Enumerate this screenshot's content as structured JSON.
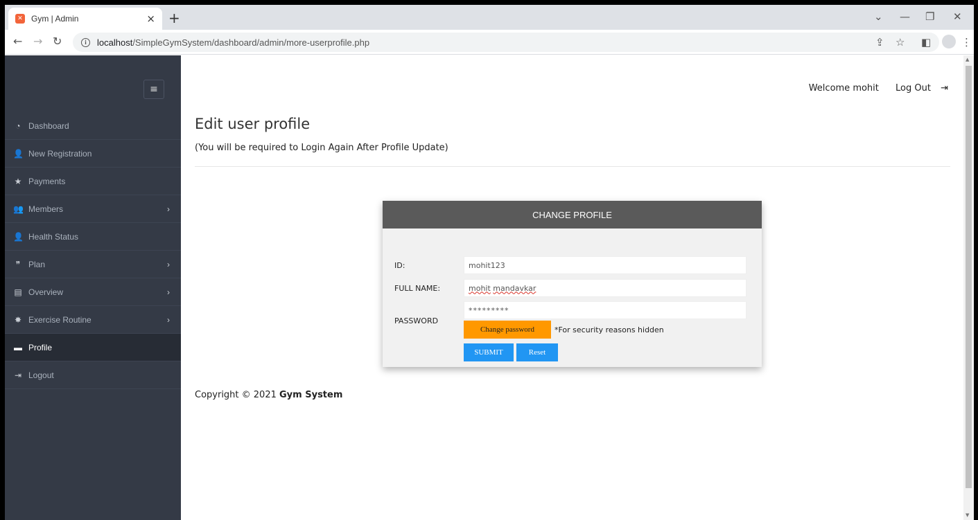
{
  "browser": {
    "tab_title": "Gym | Admin",
    "tab_close": "×",
    "new_tab": "+",
    "url_host": "localhost",
    "url_path": "/SimpleGymSystem/dashboard/admin/more-userprofile.php"
  },
  "sidebar": {
    "toggle": "≡",
    "items": [
      {
        "label": "Dashboard",
        "icon": "dashboard-icon",
        "glyph": "◔",
        "chevron": false
      },
      {
        "label": "New Registration",
        "icon": "user-plus-icon",
        "glyph": "👤",
        "chevron": false
      },
      {
        "label": "Payments",
        "icon": "star-icon",
        "glyph": "★",
        "chevron": false
      },
      {
        "label": "Members",
        "icon": "users-icon",
        "glyph": "👥",
        "chevron": true
      },
      {
        "label": "Health Status",
        "icon": "user-plus-icon",
        "glyph": "👤",
        "chevron": false
      },
      {
        "label": "Plan",
        "icon": "quote-icon",
        "glyph": "❞",
        "chevron": true
      },
      {
        "label": "Overview",
        "icon": "archive-icon",
        "glyph": "▤",
        "chevron": true
      },
      {
        "label": "Exercise Routine",
        "icon": "gear-icon",
        "glyph": "✸",
        "chevron": true
      },
      {
        "label": "Profile",
        "icon": "folder-icon",
        "glyph": "▬",
        "chevron": false,
        "active": true
      },
      {
        "label": "Logout",
        "icon": "logout-icon",
        "glyph": "⇥",
        "chevron": false
      }
    ],
    "chevron_glyph": "›"
  },
  "header": {
    "welcome": "Welcome mohit",
    "logout": "Log Out",
    "logout_glyph": "⇥"
  },
  "page": {
    "title": "Edit user profile",
    "subtitle": "(You will be required to Login Again After Profile Update)"
  },
  "form": {
    "heading": "CHANGE PROFILE",
    "id_label": "ID:",
    "id_value": "mohit123",
    "fullname_label": "FULL NAME:",
    "fullname_first": "mohit",
    "fullname_last": "mandavkar",
    "password_label": "PASSWORD",
    "password_value": "*********",
    "change_password": "Change password",
    "security_note": "*For security reasons hidden",
    "submit": "SUBMIT",
    "reset": "Reset"
  },
  "footer": {
    "copyright_prefix": "Copyright © 2021",
    "brand": "Gym System"
  }
}
